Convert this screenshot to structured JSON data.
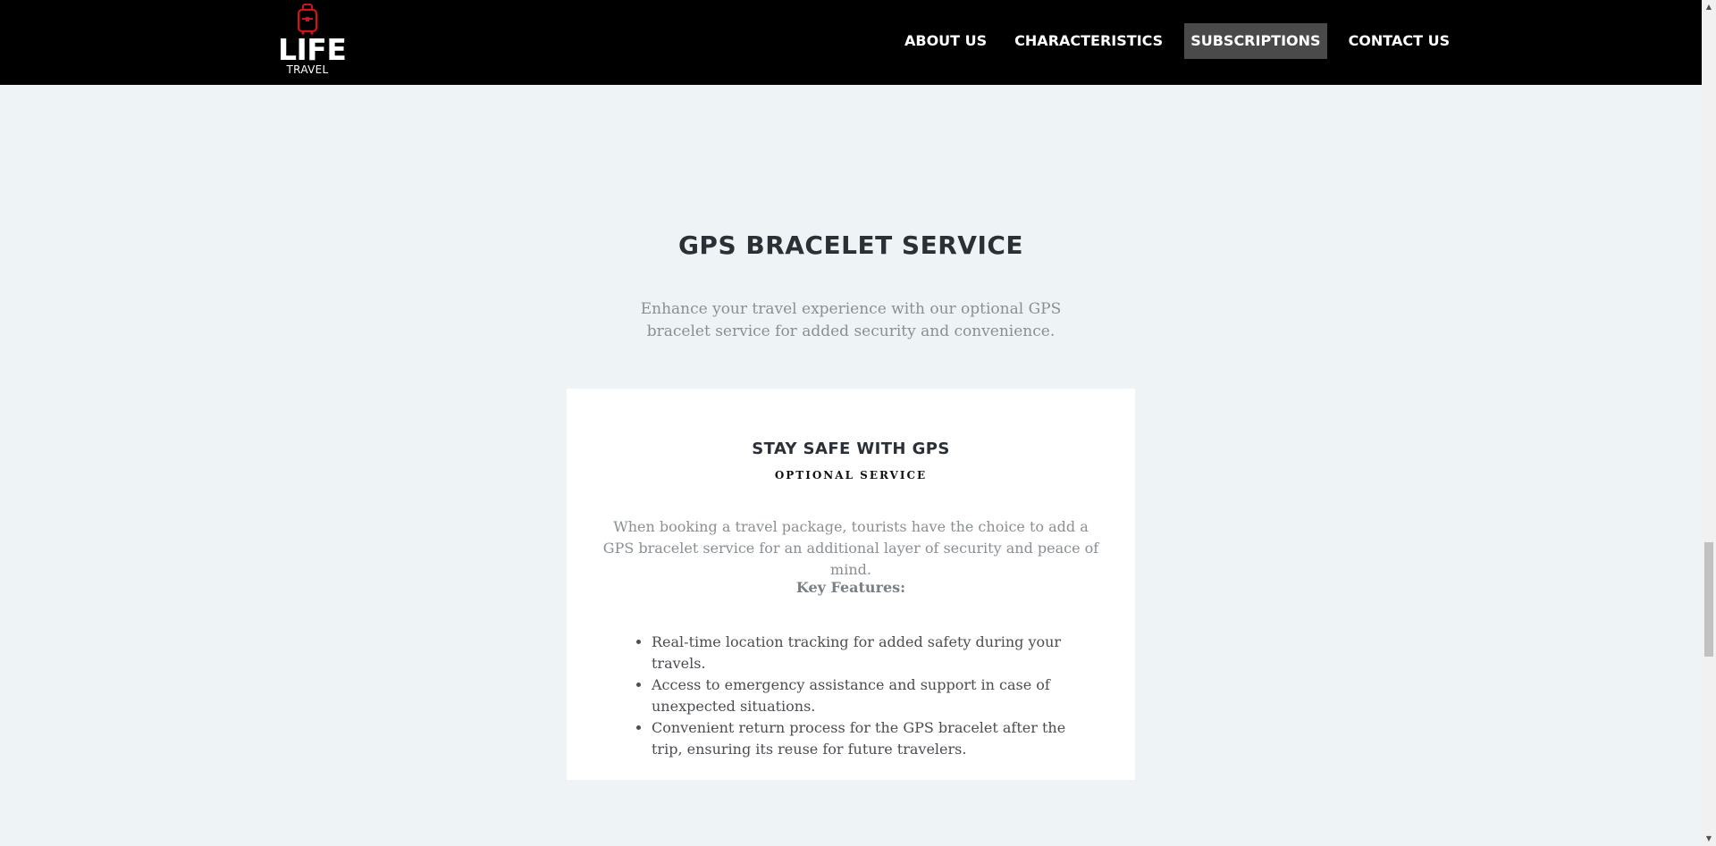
{
  "header": {
    "logo": {
      "main": "LIFE",
      "sub": "TRAVEL",
      "icon": "suitcase-icon",
      "icon_color": "#d0141e"
    },
    "nav": [
      {
        "label": "ABOUT US"
      },
      {
        "label": "CHARACTERISTICS"
      },
      {
        "label": "SUBSCRIPTIONS"
      },
      {
        "label": "CONTACT US"
      }
    ],
    "active_nav": "SUBSCRIPTIONS"
  },
  "section": {
    "title": "GPS BRACELET SERVICE",
    "subtitle": "Enhance your travel experience with our optional GPS bracelet service for added security and convenience."
  },
  "card": {
    "title": "STAY SAFE WITH GPS",
    "tag": "OPTIONAL SERVICE",
    "description": "When booking a travel package, tourists have the choice to add a GPS bracelet service for an additional layer of security and peace of mind.",
    "features_heading": "Key Features:",
    "features": [
      "Real-time location tracking for added safety during your travels.",
      "Access to emergency assistance and support in case of unexpected situations.",
      "Convenient return process for the GPS bracelet after the trip, ensuring its reuse for future travelers."
    ]
  },
  "colors": {
    "header_bg": "#000000",
    "page_bg": "#eef3f6",
    "active_nav_bg": "#4a4a4a",
    "card_bg": "#ffffff"
  }
}
